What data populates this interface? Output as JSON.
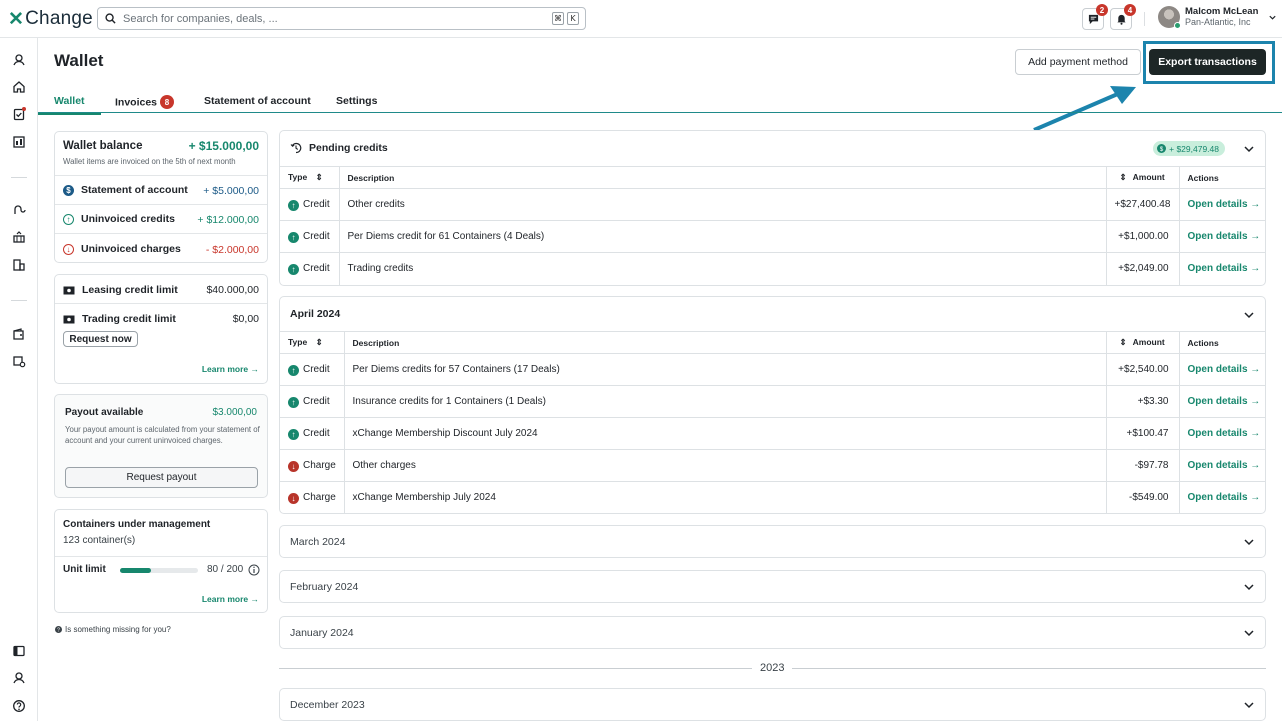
{
  "app": {
    "logo": "Change",
    "logo_mark": "✕"
  },
  "search": {
    "placeholder": "Search for companies, deals, ...",
    "kbd1": "⌘",
    "kbd2": "K"
  },
  "topbar": {
    "messages_count": "2",
    "notifications_count": "4"
  },
  "user": {
    "name": "Malcom McLean",
    "company": "Pan-Atlantic, Inc"
  },
  "page": {
    "title": "Wallet",
    "add_payment": "Add payment method",
    "export": "Export transactions"
  },
  "tabs": [
    {
      "label": "Wallet"
    },
    {
      "label": "Invoices",
      "badge": "8"
    },
    {
      "label": "Statement of account"
    },
    {
      "label": "Settings"
    }
  ],
  "balance": {
    "title": "Wallet balance",
    "value": "+ $15.000,00",
    "note": "Wallet items are invoiced on the 5th of next month",
    "rows": [
      {
        "label": "Statement of account",
        "value": "+ $5.000,00"
      },
      {
        "label": "Uninvoiced credits",
        "value": "+ $12.000,00"
      },
      {
        "label": "Uninvoiced charges",
        "value": "- $2.000,00"
      }
    ]
  },
  "credit": {
    "leasing_label": "Leasing credit limit",
    "leasing_value": "$40.000,00",
    "trading_label": "Trading credit limit",
    "trading_value": "$0,00",
    "request_now": "Request now",
    "learn_more": "Learn more →"
  },
  "payout": {
    "title": "Payout available",
    "value": "$3.000,00",
    "note": "Your payout amount is calculated from your statement of account and your current uninvoiced charges.",
    "button": "Request payout"
  },
  "containers": {
    "title": "Containers under management",
    "count": "123 container(s)",
    "limit_label": "Unit limit",
    "limit_value": "80 / 200",
    "limit_fraction": 0.4,
    "learn_more": "Learn more →"
  },
  "missing": "Is something missing for you?",
  "pending": {
    "title": "Pending credits",
    "total": "+ $29,479.48",
    "headers": [
      "Type",
      "Description",
      "Amount",
      "Actions"
    ],
    "rows": [
      {
        "type": "Credit",
        "desc": "Other credits",
        "amount": "+$27,400.48",
        "action": "Open details →"
      },
      {
        "type": "Credit",
        "desc": "Per Diems credit for 61 Containers (4 Deals)",
        "amount": "+$1,000.00",
        "action": "Open details →"
      },
      {
        "type": "Credit",
        "desc": "Trading credits",
        "amount": "+$2,049.00",
        "action": "Open details →"
      }
    ]
  },
  "april": {
    "title": "April 2024",
    "headers": [
      "Type",
      "Description",
      "Amount",
      "Actions"
    ],
    "rows": [
      {
        "type": "Credit",
        "desc": "Per Diems credits for 57 Containers (17 Deals)",
        "amount": "+$2,540.00",
        "action": "Open details →"
      },
      {
        "type": "Credit",
        "desc": "Insurance credits for 1 Containers (1 Deals)",
        "amount": "+$3.30",
        "action": "Open details →"
      },
      {
        "type": "Credit",
        "desc": "xChange Membership Discount July 2024",
        "amount": "+$100.47",
        "action": "Open details →"
      },
      {
        "type": "Charge",
        "desc": "Other charges",
        "amount": "-$97.78",
        "action": "Open details →"
      },
      {
        "type": "Charge",
        "desc": "xChange Membership July 2024",
        "amount": "-$549.00",
        "action": "Open details →"
      }
    ]
  },
  "months": [
    "March 2024",
    "February 2024",
    "January 2024"
  ],
  "year": "2023",
  "december": "December 2023"
}
